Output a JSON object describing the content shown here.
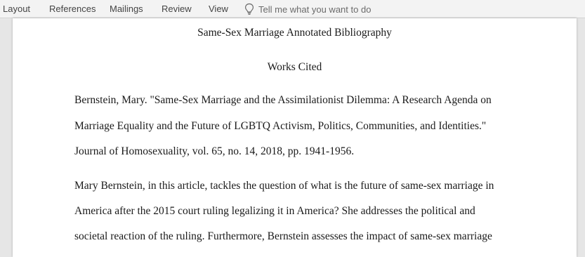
{
  "ribbon": {
    "tabs": [
      {
        "label": "Layout"
      },
      {
        "label": "References"
      },
      {
        "label": "Mailings"
      },
      {
        "label": "Review"
      },
      {
        "label": "View"
      }
    ],
    "tell_me": {
      "icon": "lightbulb-icon",
      "placeholder": "Tell me what you want to do"
    }
  },
  "document": {
    "title": "Same-Sex Marriage Annotated Bibliography",
    "heading": "Works Cited",
    "citation_lines": [
      "Bernstein, Mary. \"Same-Sex Marriage and the Assimilationist Dilemma: A Research Agenda on",
      "Marriage Equality and the Future of LGBTQ Activism, Politics, Communities, and Identities.\"",
      "Journal of Homosexuality, vol. 65, no. 14, 2018, pp. 1941-1956."
    ],
    "annotation_lines": [
      "Mary Bernstein, in this article, tackles the question of what is the future of same-sex marriage in",
      "America after the 2015 court ruling legalizing it in America? She addresses the political and",
      "societal reaction of the ruling. Furthermore, Bernstein assesses the impact of same-sex marriage",
      ""
    ]
  },
  "colors": {
    "ribbon_bg": "#f3f3f3",
    "canvas_bg": "#e6e6e6",
    "page_bg": "#ffffff",
    "text": "#1a1a1a"
  }
}
